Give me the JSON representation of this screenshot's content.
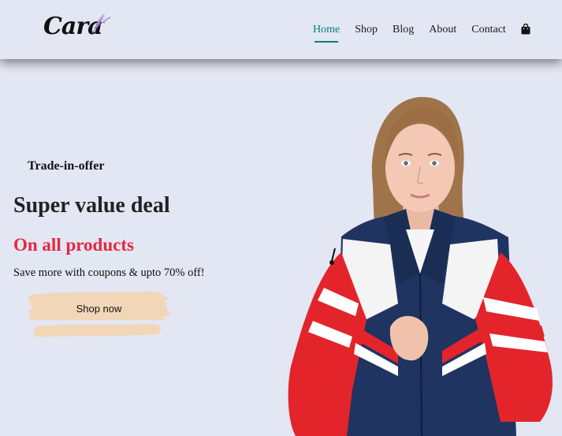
{
  "brand": {
    "logo_text": "Cara"
  },
  "nav": {
    "items": [
      {
        "label": "Home",
        "active": true
      },
      {
        "label": "Shop",
        "active": false
      },
      {
        "label": "Blog",
        "active": false
      },
      {
        "label": "About",
        "active": false
      },
      {
        "label": "Contact",
        "active": false
      }
    ],
    "cart_icon": "shopping-bag-icon"
  },
  "hero": {
    "eyebrow": "Trade-in-offer",
    "headline": "Super value deal",
    "subheadline": "On all products",
    "description": "Save more with coupons & upto 70% off!",
    "cta_label": "Shop now"
  },
  "colors": {
    "background": "#e3e6f3",
    "accent": "#088178",
    "highlight": "#e3283f",
    "button_brush": "#f2d6b8"
  }
}
